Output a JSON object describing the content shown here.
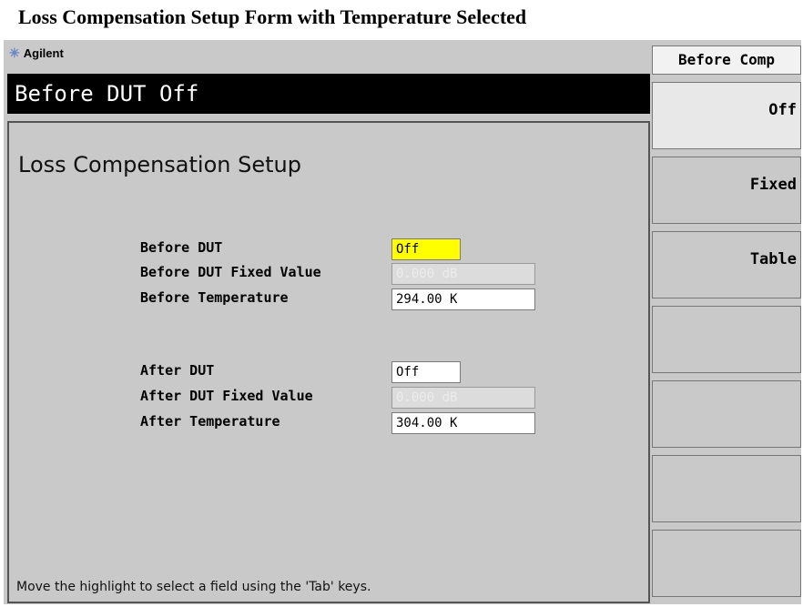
{
  "caption": "Loss Compensation Setup Form with Temperature Selected",
  "brand": {
    "name": "Agilent",
    "icon": "agilent-star-icon"
  },
  "title_bar": "Before DUT Off",
  "form": {
    "title": "Loss Compensation Setup",
    "fields": {
      "before_dut": {
        "label": "Before DUT",
        "value": "Off",
        "state": "highlighted"
      },
      "before_fixed": {
        "label": "Before DUT Fixed Value",
        "value": "0.000 dB",
        "state": "disabled"
      },
      "before_temp": {
        "label": "Before Temperature",
        "value": "294.00 K",
        "state": "normal"
      },
      "after_dut": {
        "label": "After DUT",
        "value": "Off",
        "state": "normal"
      },
      "after_fixed": {
        "label": "After DUT Fixed Value",
        "value": "0.000 dB",
        "state": "disabled"
      },
      "after_temp": {
        "label": "After Temperature",
        "value": "304.00 K",
        "state": "normal"
      }
    },
    "hint": "Move the highlight to select a field using the 'Tab' keys."
  },
  "softkeys": {
    "menu_title": "Before Comp",
    "off": "Off",
    "fixed": "Fixed",
    "table": "Table"
  },
  "colors": {
    "highlight": "#ffff00",
    "background": "#c9c9c9",
    "title_bar": "#000000"
  }
}
